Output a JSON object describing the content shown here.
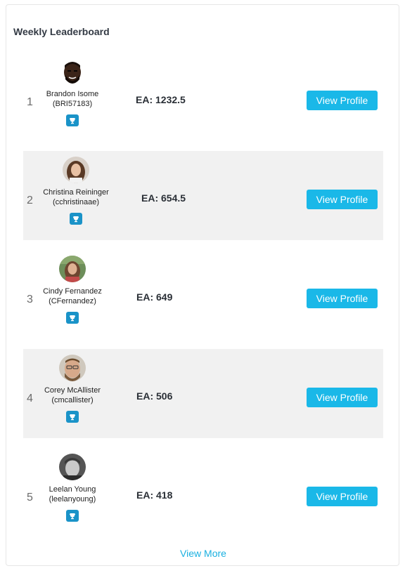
{
  "leaderboard": {
    "title": "Weekly Leaderboard",
    "view_profile_label": "View Profile",
    "view_more_label": "View More",
    "button_color": "#1ab8e8",
    "badge_color": "#1a93c8",
    "entries": [
      {
        "rank": "1",
        "name": "Brandon Isome",
        "handle": "(BRI57183)",
        "ea": "EA: 1232.5",
        "badge_icon": "trophy-icon"
      },
      {
        "rank": "2",
        "name": "Christina Reininger",
        "handle": "(cchristinaae)",
        "ea": "EA: 654.5",
        "badge_icon": "trophy-icon"
      },
      {
        "rank": "3",
        "name": "Cindy Fernandez",
        "handle": "(CFernandez)",
        "ea": "EA: 649",
        "badge_icon": "trophy-icon"
      },
      {
        "rank": "4",
        "name": "Corey McAllister",
        "handle": "(cmcallister)",
        "ea": "EA: 506",
        "badge_icon": "trophy-icon"
      },
      {
        "rank": "5",
        "name": "Leelan Young",
        "handle": "(leelanyoung)",
        "ea": "EA: 418",
        "badge_icon": "trophy-icon"
      }
    ]
  }
}
